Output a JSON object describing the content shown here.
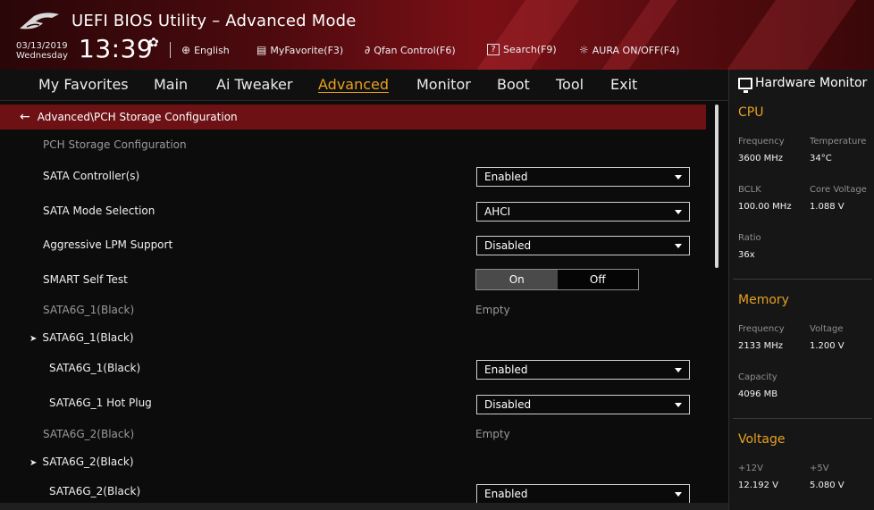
{
  "header": {
    "title": "UEFI BIOS Utility – Advanced Mode",
    "date": "03/13/2019",
    "weekday": "Wednesday",
    "time": "13:39",
    "tools": {
      "language": "English",
      "myfavorite": "MyFavorite(F3)",
      "qfan": "Qfan Control(F6)",
      "search": "Search(F9)",
      "aura": "AURA ON/OFF(F4)"
    },
    "icons": {
      "settings": "gear-icon",
      "language": "globe-icon",
      "myfavorite": "favorite-list-icon",
      "qfan": "fan-icon",
      "search": "question-box-icon",
      "aura": "aura-light-icon"
    }
  },
  "menu": {
    "items": [
      "My Favorites",
      "Main",
      "Ai Tweaker",
      "Advanced",
      "Monitor",
      "Boot",
      "Tool",
      "Exit"
    ],
    "active": "Advanced"
  },
  "breadcrumb": "Advanced\\PCH Storage Configuration",
  "settings": {
    "section_title": "PCH Storage Configuration",
    "sata_controllers": {
      "label": "SATA Controller(s)",
      "value": "Enabled"
    },
    "sata_mode": {
      "label": "SATA Mode Selection",
      "value": "AHCI"
    },
    "aggressive_lpm": {
      "label": "Aggressive LPM Support",
      "value": "Disabled"
    },
    "smart_self_test": {
      "label": "SMART Self Test",
      "on_label": "On",
      "off_label": "Off",
      "selected": "On"
    },
    "sata1_status": {
      "label": "SATA6G_1(Black)",
      "value": "Empty"
    },
    "sata1_group": {
      "label": "SATA6G_1(Black)"
    },
    "sata1_port": {
      "label": "SATA6G_1(Black)",
      "value": "Enabled"
    },
    "sata1_hotplug": {
      "label": "SATA6G_1 Hot Plug",
      "value": "Disabled"
    },
    "sata2_status": {
      "label": "SATA6G_2(Black)",
      "value": "Empty"
    },
    "sata2_group": {
      "label": "SATA6G_2(Black)"
    },
    "sata2_port": {
      "label": "SATA6G_2(Black)",
      "value": "Enabled"
    }
  },
  "hardware_monitor": {
    "title": "Hardware Monitor",
    "cpu": {
      "heading": "CPU",
      "frequency_label": "Frequency",
      "frequency": "3600 MHz",
      "temperature_label": "Temperature",
      "temperature": "34°C",
      "bclk_label": "BCLK",
      "bclk": "100.00 MHz",
      "core_voltage_label": "Core Voltage",
      "core_voltage": "1.088 V",
      "ratio_label": "Ratio",
      "ratio": "36x"
    },
    "memory": {
      "heading": "Memory",
      "frequency_label": "Frequency",
      "frequency": "2133 MHz",
      "voltage_label": "Voltage",
      "voltage": "1.200 V",
      "capacity_label": "Capacity",
      "capacity": "4096 MB"
    },
    "voltage": {
      "heading": "Voltage",
      "v12_label": "+12V",
      "v12": "12.192 V",
      "v5_label": "+5V",
      "v5": "5.080 V"
    }
  },
  "colors": {
    "accent": "#e7a020",
    "header_red": "#7a1016",
    "breadcrumb_red": "#6d1115",
    "background": "#0c0c0c"
  }
}
